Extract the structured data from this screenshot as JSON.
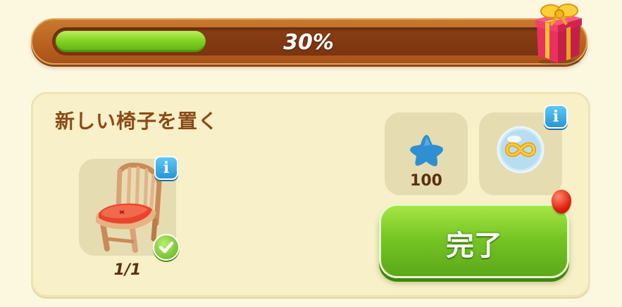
{
  "progress": {
    "percent": 30,
    "label": "30%"
  },
  "task": {
    "title": "新しい椅子を置く",
    "item_count": "1/1",
    "completed": true
  },
  "rewards": [
    {
      "icon": "blue-star-icon",
      "value": "100"
    },
    {
      "icon": "infinity-bubble-icon",
      "value": ""
    }
  ],
  "actions": {
    "done_label": "完了"
  },
  "colors": {
    "accent_green": "#76c624",
    "bar_brown": "#b9621f",
    "title_brown": "#8b4a16",
    "info_blue": "#2a95d6"
  }
}
